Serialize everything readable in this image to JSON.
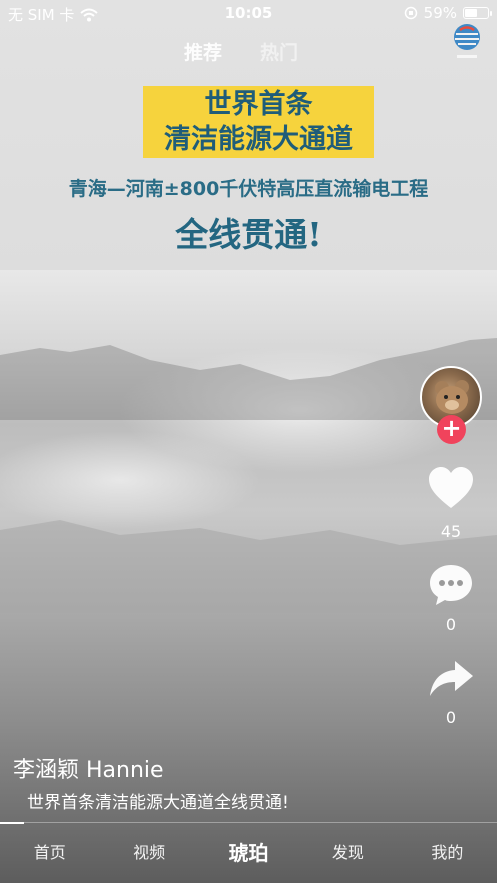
{
  "status_bar": {
    "carrier": "无 SIM 卡",
    "time": "10:05",
    "battery": "59%",
    "battery_level": 0.59
  },
  "top_tabs": [
    {
      "label": "推荐",
      "active": true
    },
    {
      "label": "热门",
      "active": false
    }
  ],
  "poster": {
    "banner_line1": "世界首条",
    "banner_line2": "清洁能源大通道",
    "subline": "青海—河南±800千伏特高压直流输电工程",
    "headline": "全线贯通!"
  },
  "right_rail": {
    "follow_symbol": "+",
    "likes": "45",
    "comments": "0",
    "shares": "0"
  },
  "caption": {
    "author": "李涵颖 Hannie",
    "description": "世界首条清洁能源大通道全线贯通!"
  },
  "bottom_nav": [
    {
      "label": "首页"
    },
    {
      "label": "视频"
    },
    {
      "label": "琥珀",
      "current": true
    },
    {
      "label": "发现"
    },
    {
      "label": "我的"
    }
  ],
  "colors": {
    "banner": "#f6d33d",
    "poster_text": "#236681",
    "follow_button": "#f0435c"
  }
}
